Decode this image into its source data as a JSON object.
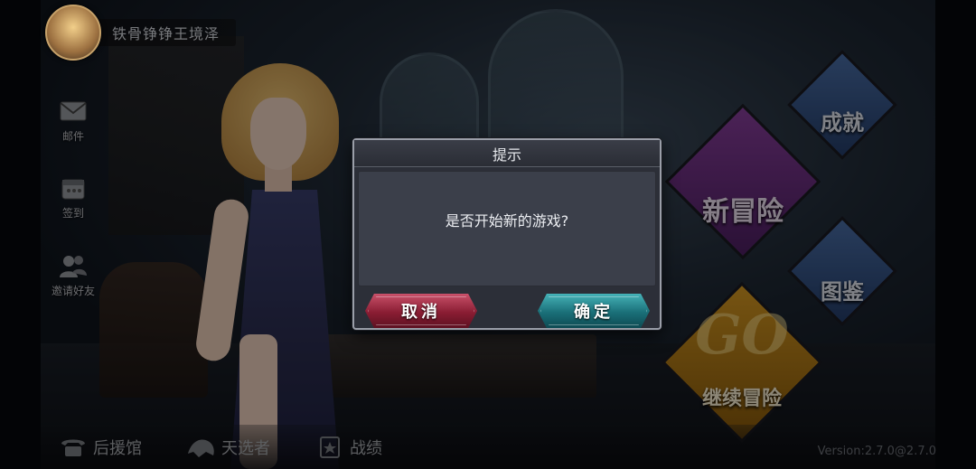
{
  "player": {
    "name": "铁骨铮铮王境泽"
  },
  "side_menu": [
    {
      "label": "邮件",
      "icon": "envelope-icon"
    },
    {
      "label": "签到",
      "icon": "calendar-icon"
    },
    {
      "label": "邀请好友",
      "icon": "friends-icon"
    }
  ],
  "main_menu": {
    "achievements": "成就",
    "new_adventure": "新冒险",
    "codex": "图鉴",
    "continue_go": "GO",
    "continue": "继续冒险"
  },
  "bottom_bar": [
    {
      "label": "后援馆",
      "icon": "phone-icon"
    },
    {
      "label": "天选者",
      "icon": "beast-icon"
    },
    {
      "label": "战绩",
      "icon": "record-icon"
    }
  ],
  "version": "Version:2.7.0@2.7.0",
  "dialog": {
    "title": "提示",
    "message": "是否开始新的游戏?",
    "cancel_label": "取消",
    "ok_label": "确定"
  },
  "colors": {
    "cancel_button": "#8a1d33",
    "ok_button": "#1a6f78",
    "new_adventure": "#6a2e82",
    "achievements": "#3a5a8c",
    "continue": "#c08418"
  }
}
